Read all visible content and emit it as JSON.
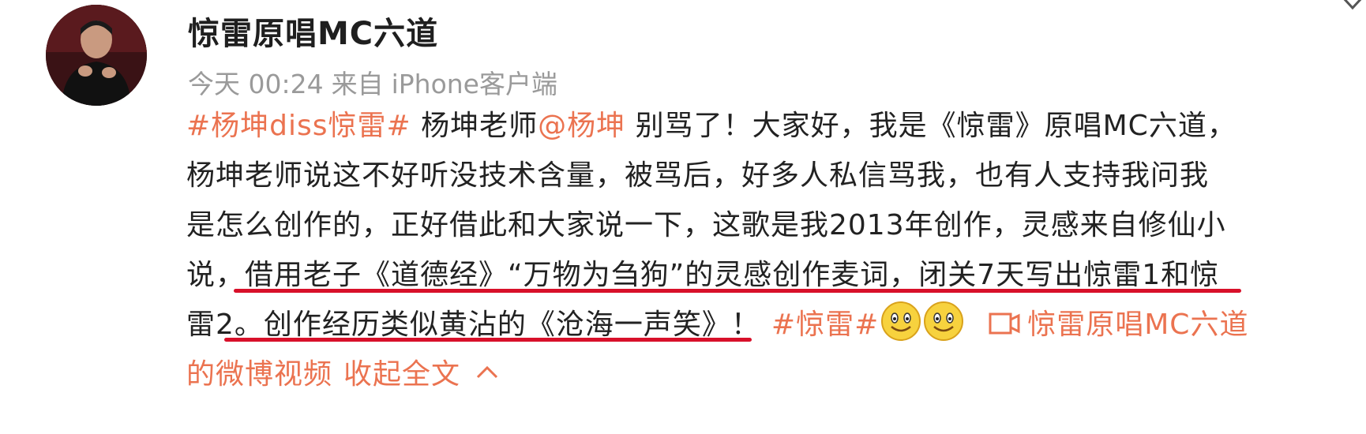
{
  "post": {
    "username": "惊雷原唱MC六道",
    "time": "今天 00:24",
    "source_prefix": "来自",
    "source": "iPhone客户端",
    "hashtag1": "#杨坤diss惊雷#",
    "text1": " 杨坤老师",
    "mention": "@杨坤",
    "text2": " 别骂了！大家好，我是《惊雷》原唱MC六道，",
    "line2": "杨坤老师说这不好听没技术含量，被骂后，好多人私信骂我，也有人支持我问我",
    "line3": "是怎么创作的，正好借此和大家说一下，这歌是我2013年创作，灵感来自修仙小",
    "line4": "说，借用老子《道德经》“万物为刍狗”的灵感创作麦词，闭关7天写出惊雷1和惊",
    "line5_text": "雷2。创作经历类似黄沾的《沧海一声笑》！",
    "hashtag2": "#惊雷#",
    "video_link_part1": "惊雷原唱MC六道",
    "video_link_part2": "的微博视频",
    "collapse": "收起全文"
  },
  "icons": {
    "avatar": "user-avatar-photo",
    "emoji": "smile-emoji-icon",
    "video": "video-icon",
    "collapse": "chevron-up-icon",
    "menu": "chevron-down-icon"
  },
  "colors": {
    "link": "#eb7350",
    "underline": "#d8102a",
    "meta": "#9a9a9a",
    "text": "#222222"
  }
}
